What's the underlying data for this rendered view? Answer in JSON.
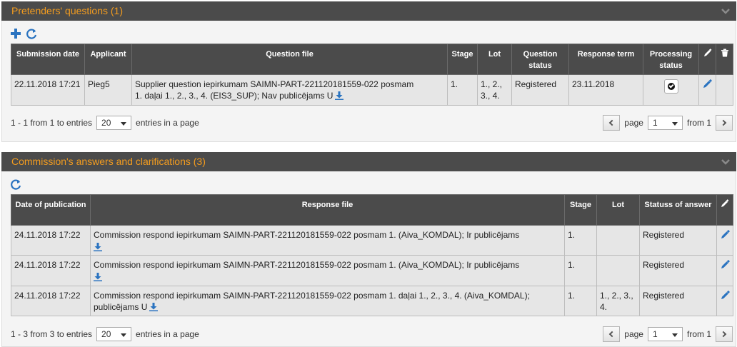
{
  "questions": {
    "title": "Pretenders' questions (1)",
    "columns": [
      "Submission date",
      "Applicant",
      "Question file",
      "Stage",
      "Lot",
      "Question status",
      "Response term",
      "Processing status"
    ],
    "rows": [
      {
        "submission_date": "22.11.2018 17:21",
        "applicant": "Pieg5",
        "file_line1": "Supplier question iepirkumam SAIMN-PART-221120181559-022 posmam",
        "file_line2": "1. daļai 1., 2., 3., 4. (EIS3_SUP); Nav publicējams U",
        "stage": "1.",
        "lot_line1": "1., 2.,",
        "lot_line2": "3., 4.",
        "status": "Registered",
        "response_term": "23.11.2018"
      }
    ],
    "pager": {
      "summary": "1 - 1 from 1 to entries",
      "page_size": "20",
      "entries_label": "entries in a page",
      "page_label": "page",
      "page_value": "1",
      "from_label": "from 1"
    }
  },
  "answers": {
    "title": "Commission's answers and clarifications (3)",
    "columns": [
      "Date of publication",
      "Response file",
      "Stage",
      "Lot",
      "Statuss of answer"
    ],
    "rows": [
      {
        "date": "24.11.2018 17:22",
        "file": " Commission respond iepirkumam SAIMN-PART-221120181559-022 posmam 1. (Aiva_KOMDAL); Ir publicējams",
        "stage": "1.",
        "lot": "",
        "status": "Registered"
      },
      {
        "date": "24.11.2018 17:22",
        "file": "Commission respond iepirkumam SAIMN-PART-221120181559-022 posmam 1. (Aiva_KOMDAL); Ir publicējams",
        "stage": "1.",
        "lot": "",
        "status": "Registered"
      },
      {
        "date": "24.11.2018 17:22",
        "file_line1": "Commission respond iepirkumam SAIMN-PART-221120181559-022 posmam 1. daļai 1., 2., 3., 4. (Aiva_KOMDAL);",
        "file_line2": "publicējams U",
        "stage": "1.",
        "lot_line1": "1., 2., 3.,",
        "lot_line2": "4.",
        "status": "Registered"
      }
    ],
    "pager": {
      "summary": "1 - 3 from 3 to entries",
      "page_size": "20",
      "entries_label": "entries in a page",
      "page_label": "page",
      "page_value": "1",
      "from_label": "from 1"
    }
  },
  "colors": {
    "header_bg": "#4b4b4b",
    "title_orange": "#f39c1f",
    "icon_blue": "#2a73c0"
  }
}
